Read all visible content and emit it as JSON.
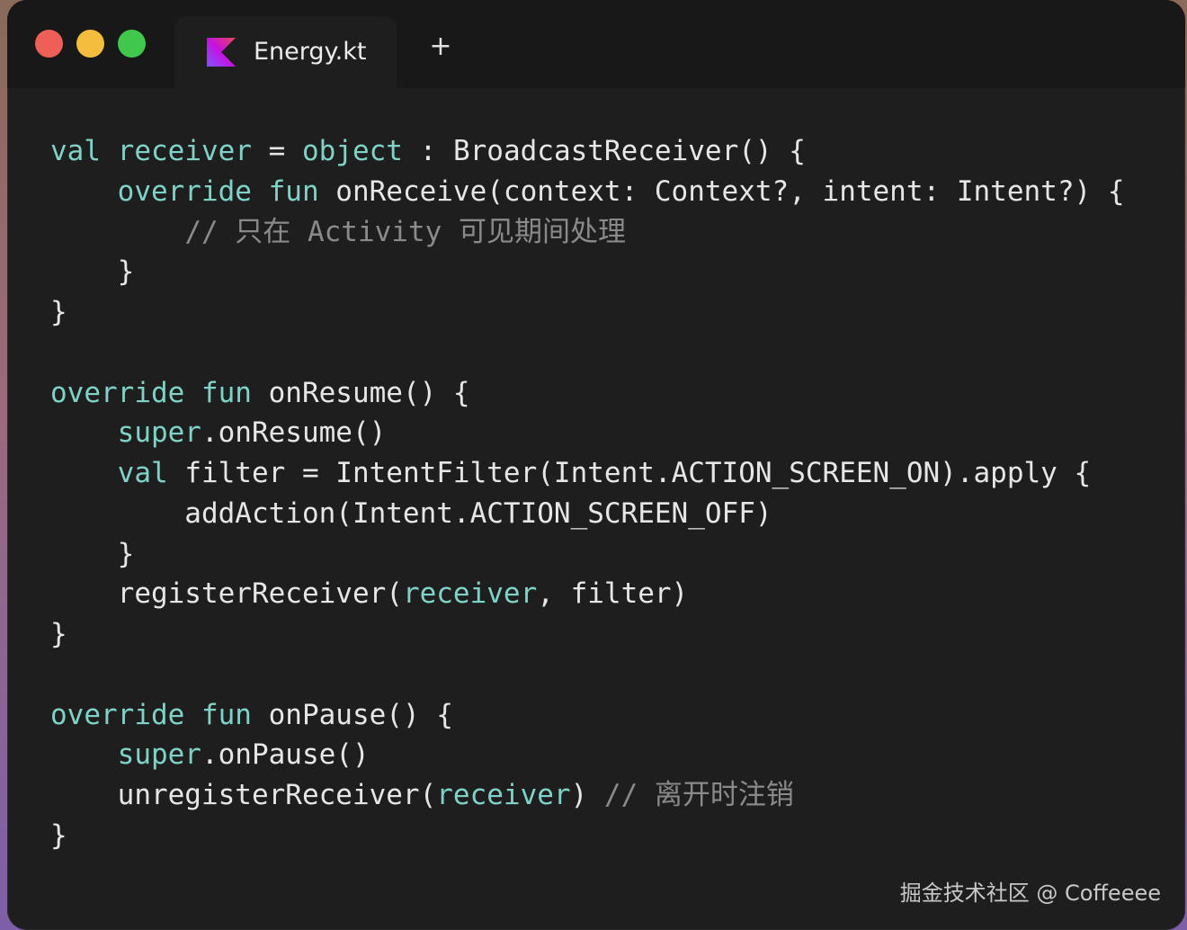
{
  "window": {
    "tab": {
      "label": "Energy.kt",
      "icon": "kotlin-icon"
    },
    "new_tab_label": "+",
    "traffic_lights": {
      "close": "#ee5f57",
      "minimize": "#f4bd3e",
      "maximize": "#3fc84c"
    }
  },
  "colors": {
    "background": "#1e1e1e",
    "keyword": "#7fd3c6",
    "text": "#e6e6e6",
    "comment": "#8a8a8a"
  },
  "code": {
    "lines": [
      [
        {
          "t": "val",
          "c": "kw"
        },
        {
          "t": " "
        },
        {
          "t": "receiver",
          "c": "kw"
        },
        {
          "t": " = "
        },
        {
          "t": "object",
          "c": "kw"
        },
        {
          "t": " : BroadcastReceiver() {"
        }
      ],
      [
        {
          "t": "    "
        },
        {
          "t": "override fun",
          "c": "kw"
        },
        {
          "t": " onReceive(context: Context?, intent: Intent?) {"
        }
      ],
      [
        {
          "t": "        "
        },
        {
          "t": "// 只在 Activity 可见期间处理",
          "c": "cm"
        }
      ],
      [
        {
          "t": "    }"
        }
      ],
      [
        {
          "t": "}"
        }
      ],
      [],
      [
        {
          "t": "override fun",
          "c": "kw"
        },
        {
          "t": " onResume() {"
        }
      ],
      [
        {
          "t": "    "
        },
        {
          "t": "super",
          "c": "kw"
        },
        {
          "t": ".onResume()"
        }
      ],
      [
        {
          "t": "    "
        },
        {
          "t": "val",
          "c": "kw"
        },
        {
          "t": " filter = IntentFilter(Intent.ACTION_SCREEN_ON).apply {"
        }
      ],
      [
        {
          "t": "        addAction(Intent.ACTION_SCREEN_OFF)"
        }
      ],
      [
        {
          "t": "    }"
        }
      ],
      [
        {
          "t": "    registerReceiver("
        },
        {
          "t": "receiver",
          "c": "kw"
        },
        {
          "t": ", filter)"
        }
      ],
      [
        {
          "t": "}"
        }
      ],
      [],
      [
        {
          "t": "override fun",
          "c": "kw"
        },
        {
          "t": " onPause() {"
        }
      ],
      [
        {
          "t": "    "
        },
        {
          "t": "super",
          "c": "kw"
        },
        {
          "t": ".onPause()"
        }
      ],
      [
        {
          "t": "    unregisterReceiver("
        },
        {
          "t": "receiver",
          "c": "kw"
        },
        {
          "t": ") "
        },
        {
          "t": "// 离开时注销",
          "c": "cm"
        }
      ],
      [
        {
          "t": "}"
        }
      ]
    ]
  },
  "watermark": "掘金技术社区 @ Coffeeee"
}
